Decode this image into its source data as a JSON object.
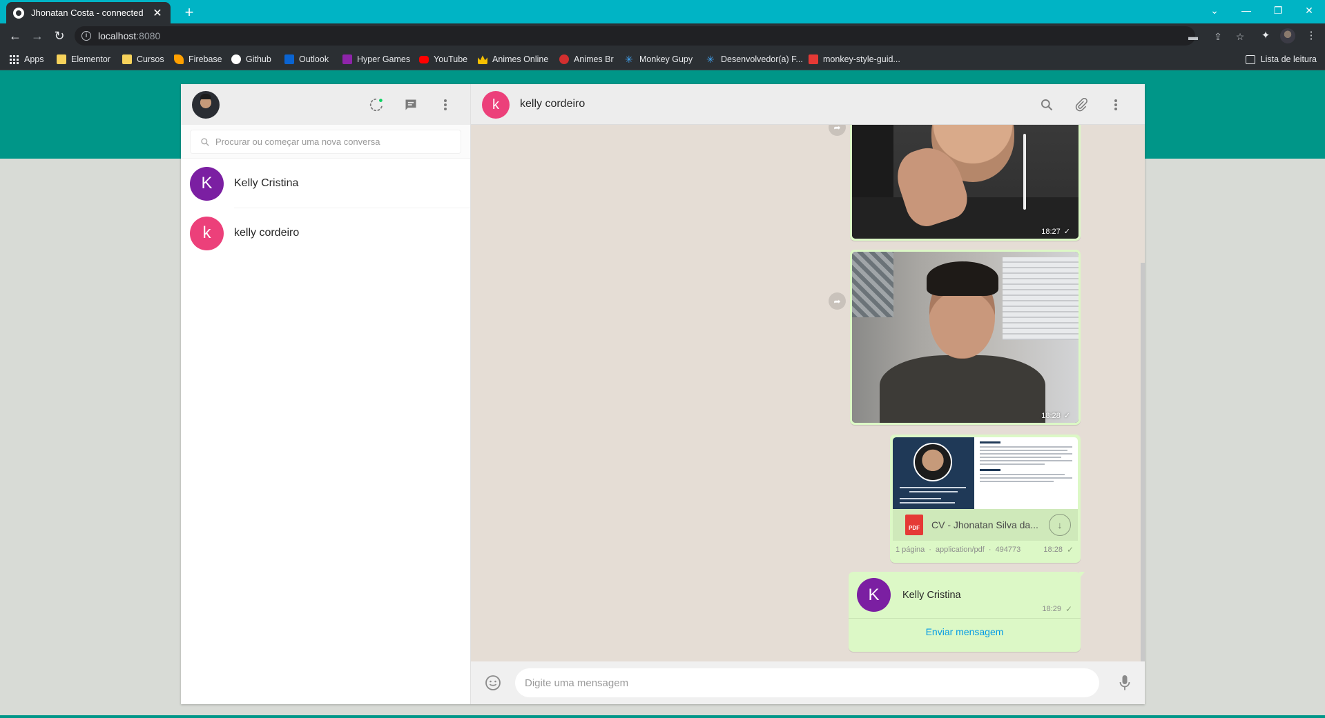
{
  "browser": {
    "tab_title": "Jhonatan Costa - connected",
    "tab_close": "✕",
    "new_tab": "+",
    "url_host": "localhost",
    "url_port": ":8080",
    "window_controls": [
      "⌄",
      "—",
      "❐",
      "✕"
    ],
    "reading_list": "Lista de leitura",
    "bookmarks": [
      {
        "label": "Apps",
        "icon": "apps-grid-icon",
        "color": "#e8eaed"
      },
      {
        "label": "Elementor",
        "icon": "folder-icon",
        "color": "#f6d25b"
      },
      {
        "label": "Cursos",
        "icon": "folder-icon",
        "color": "#f6d25b"
      },
      {
        "label": "Firebase",
        "icon": "firebase-icon",
        "color": "#ffa000"
      },
      {
        "label": "Github",
        "icon": "github-icon",
        "color": "#ffffff"
      },
      {
        "label": "Outlook",
        "icon": "outlook-icon",
        "color": "#0a64d2"
      },
      {
        "label": "Hyper Games",
        "icon": "hyper-games-icon",
        "color": "#8e24aa"
      },
      {
        "label": "YouTube",
        "icon": "youtube-icon",
        "color": "#ff0000"
      },
      {
        "label": "Animes Online",
        "icon": "crown-icon",
        "color": "#f6c000"
      },
      {
        "label": "Animes Br",
        "icon": "animes-br-icon",
        "color": "#d32f2f"
      },
      {
        "label": "Monkey Gupy",
        "icon": "monkey-gupy-icon",
        "color": "#42a5f5"
      },
      {
        "label": "Desenvolvedor(a) F...",
        "icon": "gear-icon",
        "color": "#42a5f5"
      },
      {
        "label": "monkey-style-guid...",
        "icon": "page-icon",
        "color": "#e53935"
      }
    ]
  },
  "sidebar": {
    "search_placeholder": "Procurar ou começar uma nova conversa",
    "chats": [
      {
        "letter": "K",
        "name": "Kelly Cristina",
        "color": "#7b1fa2"
      },
      {
        "letter": "k",
        "name": "kelly cordeiro",
        "color": "#ec407a"
      }
    ]
  },
  "conversation": {
    "contact_letter": "k",
    "contact_name": "kelly cordeiro",
    "messages": {
      "image1_time": "18:27",
      "image2_time": "18:28",
      "document": {
        "file_name": "CV - Jhonatan Silva da...",
        "pdf_label": "PDF",
        "pages": "1 página",
        "mime": "application/pdf",
        "size": "494773",
        "time": "18:28"
      },
      "contact_card": {
        "letter": "K",
        "name": "Kelly Cristina",
        "time": "18:29",
        "action": "Enviar mensagem"
      }
    },
    "composer_placeholder": "Digite uma mensagem"
  },
  "colors": {
    "brand_teal": "#009688",
    "bubble_green": "#dcf8c6",
    "link_blue": "#039be5"
  }
}
